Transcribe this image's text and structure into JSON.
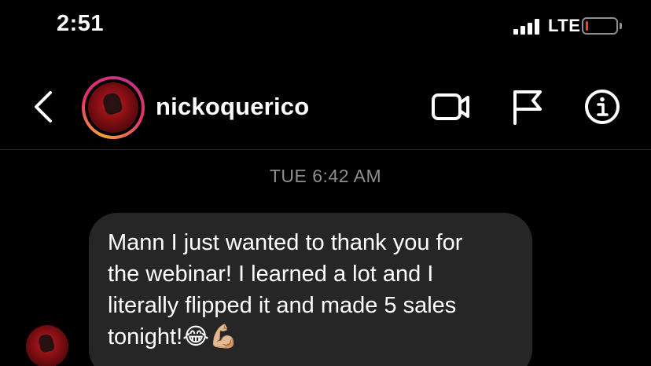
{
  "status_bar": {
    "time": "2:51",
    "network": "LTE",
    "battery_level": 0.08,
    "battery_color": "#ff3b30"
  },
  "header": {
    "back_icon": "chevron-left-icon",
    "username": "nickoquerico",
    "actions": [
      "video-call-icon",
      "flag-icon",
      "info-icon"
    ]
  },
  "thread": {
    "timestamp": "TUE 6:42 AM",
    "messages": [
      {
        "text": "Mann I just wanted to thank you for\nthe webinar! I learned a lot and I\nliterally flipped it and made 5 sales\ntonight!😂💪🏼"
      }
    ]
  },
  "colors": {
    "background": "#000000",
    "bubble": "#262626",
    "timestamp": "#8e8e93",
    "divider": "#262626"
  }
}
